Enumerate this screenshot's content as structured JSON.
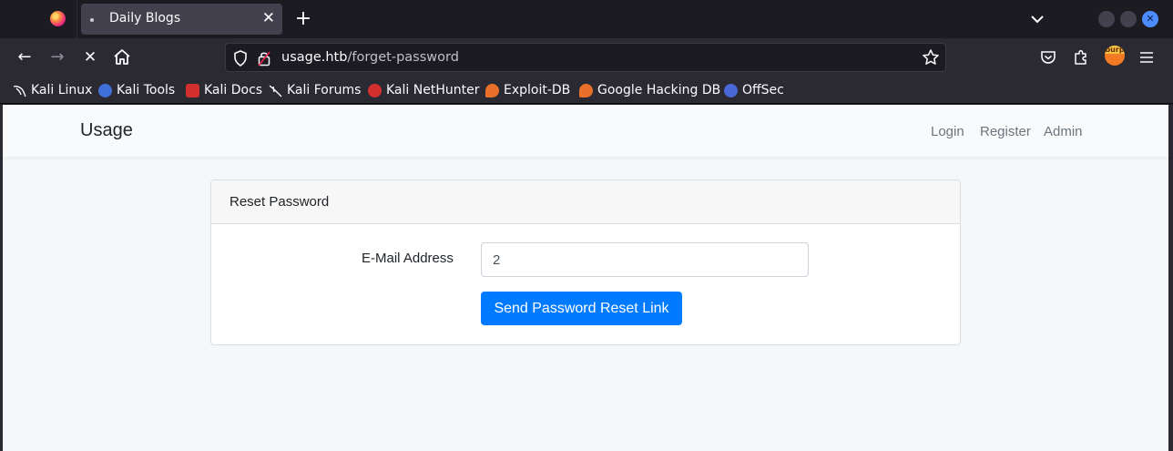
{
  "browser": {
    "tab": {
      "title": "Daily Blogs",
      "close": "✕"
    },
    "new_tab": "+",
    "url": {
      "host": "usage.htb",
      "path": "/forget-password"
    },
    "nav": {
      "back": "←",
      "forward": "→",
      "stop": "✕",
      "home": "⌂"
    }
  },
  "bookmarks": [
    {
      "label": "Kali Linux",
      "icon": "kali-dragon-icon",
      "color": "#2b2a33"
    },
    {
      "label": "Kali Tools",
      "icon": "kali-tools-icon",
      "color": "#3f6fd8"
    },
    {
      "label": "Kali Docs",
      "icon": "kali-docs-icon",
      "color": "#d32f2f"
    },
    {
      "label": "Kali Forums",
      "icon": "kali-forums-icon",
      "color": "#2b2a33"
    },
    {
      "label": "Kali NetHunter",
      "icon": "nethunter-icon",
      "color": "#d32f2f"
    },
    {
      "label": "Exploit-DB",
      "icon": "exploit-db-icon",
      "color": "#e8702a"
    },
    {
      "label": "Google Hacking DB",
      "icon": "ghdb-icon",
      "color": "#e8702a"
    },
    {
      "label": "OffSec",
      "icon": "offsec-icon",
      "color": "#4a67d6"
    }
  ],
  "site": {
    "brand": "Usage",
    "nav_links": [
      "Login",
      "Register",
      "Admin"
    ]
  },
  "card": {
    "title": "Reset Password",
    "email_label": "E-Mail Address",
    "email_value": "2",
    "submit_label": "Send Password Reset Link"
  },
  "burp_label": "burp",
  "colors": {
    "primary_button": "#007bff",
    "page_background": "#f5f8fa",
    "chrome_dark": "#1c1b22",
    "chrome_toolbar": "#2b2a33"
  }
}
